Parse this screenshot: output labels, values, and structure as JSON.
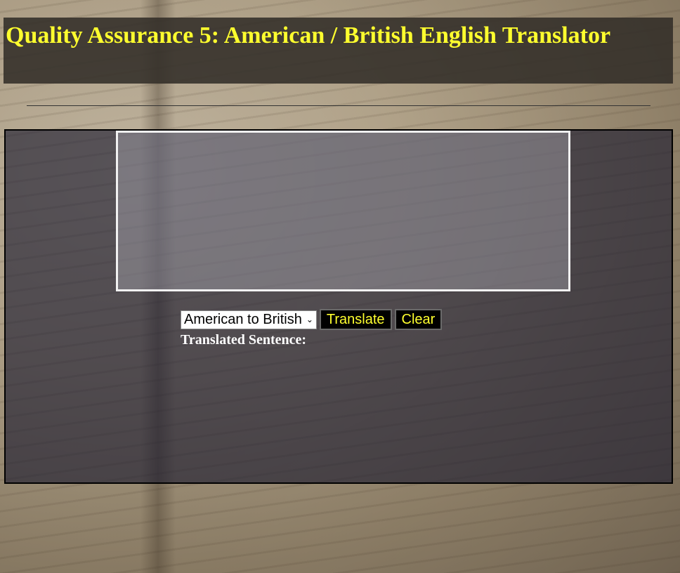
{
  "header": {
    "title": "Quality Assurance 5: American / British English Translator"
  },
  "form": {
    "text_input_value": "",
    "locale_select": {
      "selected": "American to British",
      "options": [
        "American to British"
      ]
    },
    "translate_button_label": "Translate",
    "clear_button_label": "Clear"
  },
  "output": {
    "label": "Translated Sentence:",
    "value": ""
  },
  "colors": {
    "title_text": "#ffff2e",
    "button_text": "#ffff2e",
    "button_bg": "#000000"
  },
  "icons": {
    "select_indicator": "chevron-down-icon"
  }
}
